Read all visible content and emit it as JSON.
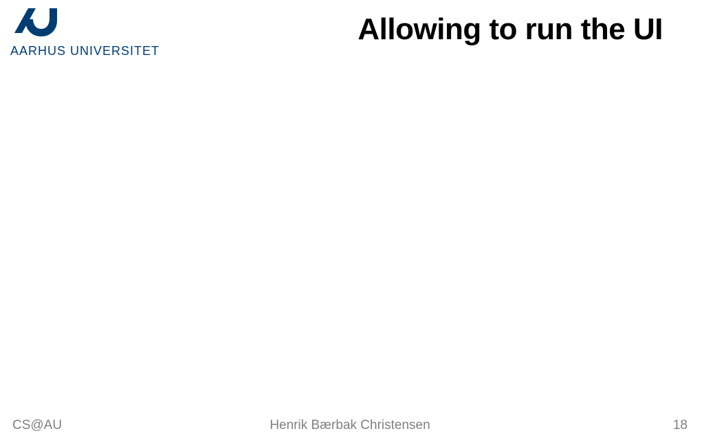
{
  "header": {
    "logo_text": "AARHUS UNIVERSITET",
    "title": "Allowing to run the UI"
  },
  "footer": {
    "left": "CS@AU",
    "center": "Henrik Bærbak Christensen",
    "page_number": "18"
  },
  "colors": {
    "brand": "#003d73"
  }
}
